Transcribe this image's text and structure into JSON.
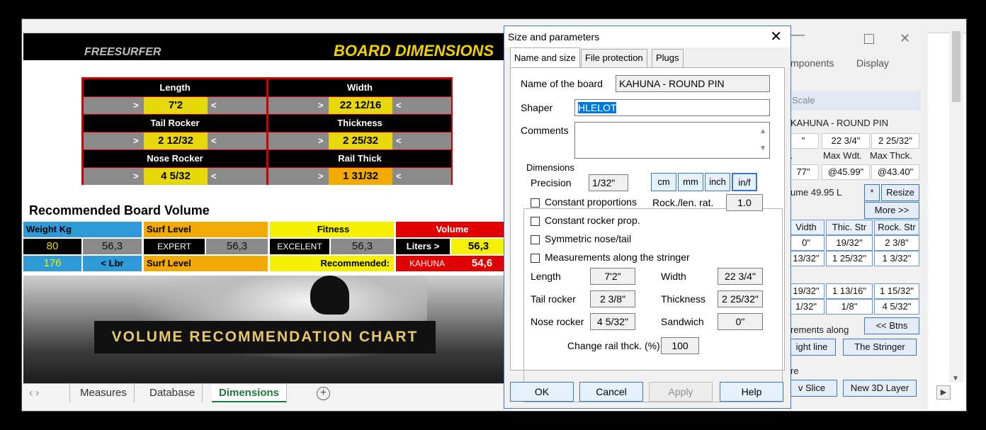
{
  "sheet": {
    "brand": "FREESURFER",
    "title": "BOARD DIMENSIONS",
    "dims": [
      {
        "label": "Length",
        "value": "7'2",
        "color": "yellow"
      },
      {
        "label": "Width",
        "value": "22 12/16",
        "color": "yellow"
      },
      {
        "label": "Tail  Rocker",
        "value": "2 12/32",
        "color": "yellow"
      },
      {
        "label": "Thickness",
        "value": "2 25/32",
        "color": "yellow"
      },
      {
        "label": "Nose Rocker",
        "value": "4 5/32",
        "color": "yellow"
      },
      {
        "label": "Rail Thick",
        "value": "1 31/32",
        "color": "orange"
      }
    ],
    "arrow_left": ">",
    "arrow_right": "<",
    "rec_title": "Recommended Board Volume",
    "vol": {
      "weight_label": "Weight Kg",
      "surf_label": "Surf Level",
      "fitness_label": "Fitness",
      "volume_label": "Volume",
      "weight": "80",
      "weight_factor": "56,3",
      "surf": "EXPERT",
      "surf_factor": "56,3",
      "fitness": "EXCELENT",
      "fitness_factor": "56,3",
      "liters_label": "Liters >",
      "liters": "56,3",
      "lbs": "176",
      "lbs_label": "< Lbr",
      "surf_label2": "Surf Level",
      "recommended_label": "Recommended:",
      "model": "KAHUNA",
      "model_volume": "54,6"
    },
    "chart_label": "VOLUME RECOMMENDATION CHART",
    "tabs": [
      "Measures",
      "Database",
      "Dimensions"
    ],
    "active_tab": "Dimensions",
    "add_tab": "+"
  },
  "bgapp": {
    "menu1": "mponents",
    "menu2": "Display",
    "scale": "Scale",
    "board": "KAHUNA - ROUND PIN",
    "r1": [
      "\"",
      "22 3/4\"",
      "2 25/32\""
    ],
    "r2": [
      "t.",
      "Max Wdt.",
      "Max Thck."
    ],
    "r3": [
      "77\"",
      "@45.99\"",
      "@43.40\""
    ],
    "volume": "ume 49.95 L",
    "star": "*",
    "resize": "Resize",
    "more": "More >>",
    "cols": [
      "Vidth",
      "Thic. Str",
      "Rock. Str"
    ],
    "row1": [
      "0\"",
      "19/32\"",
      "2 3/8\""
    ],
    "row2": [
      "13/32\"",
      "1 25/32\"",
      "1 3/32\""
    ],
    "row3": [
      "19/32\"",
      "1 13/16\"",
      "1 15/32\""
    ],
    "row4": [
      "1/32\"",
      "1/8\"",
      "4 5/32\""
    ],
    "btns": "<< Btns",
    "measure_along": "rements along",
    "straight": "ight line",
    "stringer": "The Stringer",
    "re": "re",
    "slice": "v Slice",
    "new3d": "New 3D Layer"
  },
  "dialog": {
    "title": "Size and parameters",
    "tabs": [
      "Name and size",
      "File protection",
      "Plugs"
    ],
    "name_label": "Name of the board",
    "name": "KAHUNA - ROUND PIN",
    "shaper_label": "Shaper",
    "shaper": "HLELOT",
    "comments_label": "Comments",
    "dimensions_label": "Dimensions",
    "precision_label": "Precision",
    "precision": "1/32\"",
    "units": [
      "cm",
      "mm",
      "inch",
      "in/f"
    ],
    "const_prop": "Constant proportions",
    "const_rocker": "Constant rocker prop.",
    "symmetric": "Symmetric nose/tail",
    "along_stringer": "Measurements along the stringer",
    "rock_len_label": "Rock./len. rat.",
    "rock_len": "1.0",
    "length_label": "Length",
    "length": "7'2\"",
    "width_label": "Width",
    "width": "22 3/4\"",
    "tail_label": "Tail rocker",
    "tail": "2 3/8\"",
    "thick_label": "Thickness",
    "thick": "2 25/32\"",
    "nose_label": "Nose rocker",
    "nose": "4 5/32\"",
    "sandwich_label": "Sandwich",
    "sandwich": "0\"",
    "rail_label": "Change rail thck. (%)",
    "rail": "100",
    "ok": "OK",
    "cancel": "Cancel",
    "apply": "Apply",
    "help": "Help"
  }
}
